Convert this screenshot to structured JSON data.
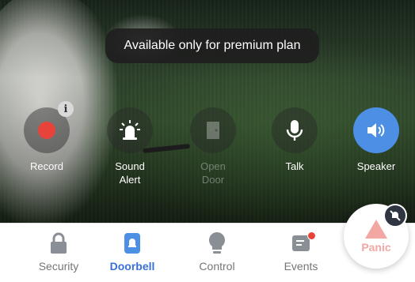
{
  "notice": {
    "text": "Available only for premium plan"
  },
  "controls": [
    {
      "label": "Record",
      "icon": "record-icon",
      "state": "normal"
    },
    {
      "label": "Sound\nAlert",
      "icon": "siren-icon",
      "state": "normal"
    },
    {
      "label": "Open\nDoor",
      "icon": "door-icon",
      "state": "disabled"
    },
    {
      "label": "Talk",
      "icon": "microphone-icon",
      "state": "normal"
    },
    {
      "label": "Speaker",
      "icon": "speaker-icon",
      "state": "active"
    }
  ],
  "tabs": [
    {
      "label": "Security",
      "icon": "lock-icon",
      "active": false
    },
    {
      "label": "Doorbell",
      "icon": "doorbell-icon",
      "active": true
    },
    {
      "label": "Control",
      "icon": "bulb-icon",
      "active": false
    },
    {
      "label": "Events",
      "icon": "events-icon",
      "active": false,
      "notification": true
    }
  ],
  "panic": {
    "label": "Panic",
    "icon": "warning-triangle-icon"
  },
  "colors": {
    "accent": "#3a6fd8",
    "speaker_active": "#4e8fe6",
    "record_red": "#e8433a",
    "panic_pink": "#f2a7a3"
  }
}
